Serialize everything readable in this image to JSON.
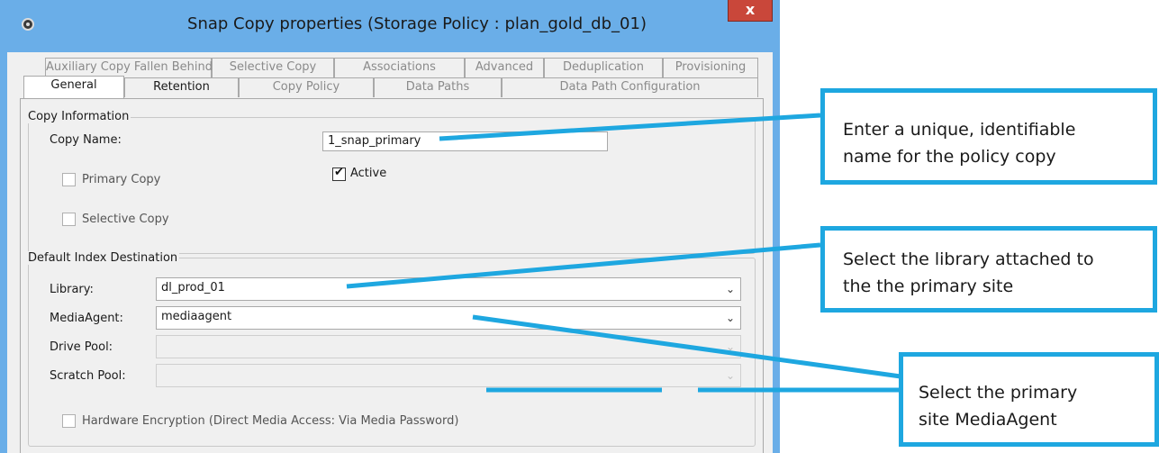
{
  "window": {
    "title": "Snap Copy properties (Storage Policy : plan_gold_db_01)",
    "close_label": "x"
  },
  "tabs": {
    "row1": [
      "Auxiliary Copy Fallen Behind",
      "Selective Copy",
      "Associations",
      "Advanced",
      "Deduplication",
      "Provisioning"
    ],
    "row2": [
      "General",
      "Retention",
      "Copy Policy",
      "Data Paths",
      "Data Path Configuration"
    ],
    "active": "General"
  },
  "copy_information": {
    "group_label": "Copy Information",
    "copy_name_label": "Copy Name:",
    "copy_name_value": "1_snap_primary",
    "primary_copy_label": "Primary Copy",
    "primary_copy_checked": false,
    "active_label": "Active",
    "active_checked": true,
    "selective_copy_label": "Selective Copy",
    "selective_copy_checked": false
  },
  "default_index_destination": {
    "group_label": "Default Index Destination",
    "library_label": "Library:",
    "library_value": "dl_prod_01",
    "mediaagent_label": "MediaAgent:",
    "mediaagent_value": "mediaagent",
    "drive_pool_label": "Drive Pool:",
    "drive_pool_value": "",
    "scratch_pool_label": "Scratch Pool:",
    "scratch_pool_value": "",
    "hardware_encryption_label": "Hardware Encryption (Direct Media Access: Via Media Password)",
    "hardware_encryption_checked": false
  },
  "callouts": {
    "copy_name": [
      "Enter a unique, identifiable",
      "name for the policy copy"
    ],
    "library": [
      "Select the library attached to",
      "the the primary site"
    ],
    "mediaagent": [
      "Select the primary",
      "site MediaAgent"
    ]
  },
  "colors": {
    "title_bar": "#6aaee8",
    "callout_accent": "#1ea7e0",
    "close_button": "#c9473a"
  },
  "icons": {
    "app": "app-icon",
    "close": "close-icon",
    "dropdown": "chevron-down-icon",
    "check": "checkmark-icon"
  }
}
